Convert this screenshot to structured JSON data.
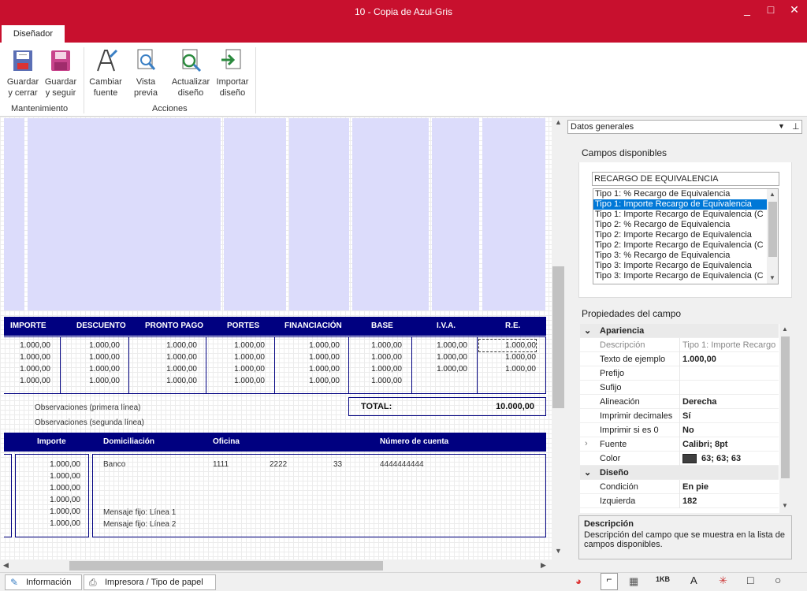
{
  "window": {
    "title": "10 - Copia de Azul-Gris",
    "minimize": "_",
    "maximize": "□",
    "close": "✕"
  },
  "tabs": {
    "active": "Diseñador"
  },
  "ribbon": {
    "groups": [
      {
        "label": "Mantenimiento"
      },
      {
        "label": "Acciones"
      }
    ],
    "buttons": [
      {
        "line1": "Guardar",
        "line2": "y cerrar",
        "icon": "save-close-icon"
      },
      {
        "line1": "Guardar",
        "line2": "y seguir",
        "icon": "save-continue-icon"
      },
      {
        "line1": "Cambiar",
        "line2": "fuente",
        "icon": "change-font-icon"
      },
      {
        "line1": "Vista",
        "line2": "previa",
        "icon": "preview-icon"
      },
      {
        "line1": "Actualizar",
        "line2": "diseño",
        "icon": "refresh-design-icon"
      },
      {
        "line1": "Importar",
        "line2": "diseño",
        "icon": "import-design-icon"
      }
    ]
  },
  "totals_header": [
    "IMPORTE",
    "DESCUENTO",
    "PRONTO PAGO",
    "PORTES",
    "FINANCIACIÓN",
    "BASE",
    "I.V.A.",
    "R.E."
  ],
  "totals_cols": [
    [
      "1.000,00",
      "1.000,00",
      "1.000,00",
      "1.000,00"
    ],
    [
      "1.000,00",
      "1.000,00",
      "1.000,00",
      "1.000,00"
    ],
    [
      "1.000,00",
      "1.000,00",
      "1.000,00",
      "1.000,00"
    ],
    [
      "1.000,00",
      "1.000,00",
      "1.000,00",
      "1.000,00"
    ],
    [
      "1.000,00",
      "1.000,00",
      "1.000,00",
      "1.000,00"
    ],
    [
      "1.000,00",
      "1.000,00",
      "1.000,00",
      "1.000,00"
    ],
    [
      "1.000,00",
      "1.000,00",
      "1.000,00"
    ],
    [
      "1.000,00",
      "1.000,00",
      "1.000,00"
    ]
  ],
  "observations": [
    "Observaciones (primera línea)",
    "Observaciones (segunda línea)"
  ],
  "total": {
    "label": "TOTAL:",
    "value": "10.000,00"
  },
  "payment_header": [
    "Importe",
    "Domiciliación",
    "Oficina",
    "Número de cuenta"
  ],
  "payment": {
    "amounts": [
      "1.000,00",
      "1.000,00",
      "1.000,00",
      "1.000,00",
      "1.000,00",
      "1.000,00"
    ],
    "bank": "Banco",
    "office": "1111",
    "branch": "2222",
    "dc": "33",
    "account": "4444444444",
    "fixed_messages": [
      "Mensaje fijo: Línea 1",
      "Mensaje fijo: Línea 2"
    ]
  },
  "bottom_tabs": [
    "Información",
    "Impresora / Tipo de papel"
  ],
  "right_panel": {
    "dropdown": "Datos generales",
    "available_title": "Campos disponibles",
    "search_value": "RECARGO DE EQUIVALENCIA",
    "fields": [
      "Tipo 1: % Recargo de Equivalencia",
      "Tipo 1: Importe Recargo de Equivalencia",
      "Tipo 1: Importe Recargo de Equivalencia (C",
      "Tipo 2: % Recargo de Equivalencia",
      "Tipo 2: Importe Recargo de Equivalencia",
      "Tipo 2: Importe Recargo de Equivalencia (C",
      "Tipo 3: % Recargo de Equivalencia",
      "Tipo 3: Importe Recargo de Equivalencia",
      "Tipo 3: Importe Recargo de Equivalencia (C"
    ],
    "selected_field_index": 1,
    "props_title": "Propiedades del campo",
    "props": [
      {
        "cat": true,
        "name": "Apariencia"
      },
      {
        "name": "Descripción",
        "value": "Tipo 1: Importe Recargo",
        "muted": true
      },
      {
        "name": "Texto de ejemplo",
        "value": "1.000,00"
      },
      {
        "name": "Prefijo",
        "value": ""
      },
      {
        "name": "Sufijo",
        "value": ""
      },
      {
        "name": "Alineación",
        "value": "Derecha"
      },
      {
        "name": "Imprimir decimales",
        "value": "Sí"
      },
      {
        "name": "Imprimir si es 0",
        "value": "No"
      },
      {
        "name": "Fuente",
        "value": "Calibri; 8pt",
        "expand": true
      },
      {
        "name": "Color",
        "value": "63; 63; 63",
        "swatch": "#3f3f3f"
      },
      {
        "cat": true,
        "name": "Diseño"
      },
      {
        "name": "Condición",
        "value": "En pie"
      },
      {
        "name": "Izquierda",
        "value": "182"
      }
    ],
    "desc_title": "Descripción",
    "desc_text": "Descripción del campo que se muestra en la lista de campos disponibles."
  },
  "colors": {
    "titlebar": "#c8102e",
    "header_band": "#000080",
    "column_bands": "#dcdcfb"
  }
}
